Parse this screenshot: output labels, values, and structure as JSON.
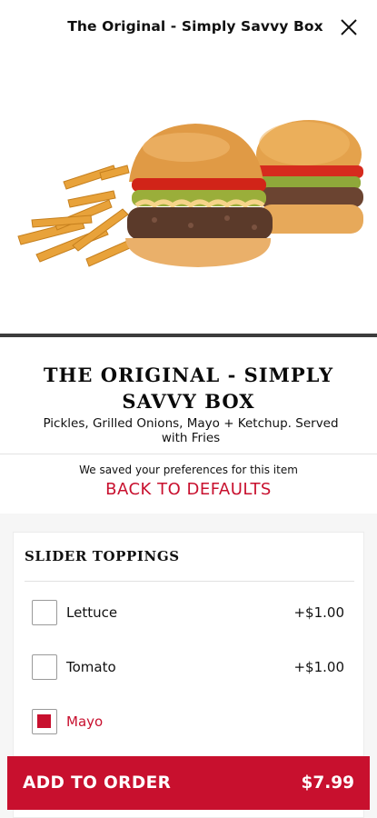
{
  "header": {
    "title": "The Original - Simply Savvy Box"
  },
  "product": {
    "name_line1": "THE ORIGINAL - SIMPLY",
    "name_line2": "SAVVY BOX",
    "desc_line1": "Pickles, Grilled Onions, Mayo + Ketchup. Served",
    "desc_line2": "with Fries"
  },
  "preferences": {
    "note": "We saved your preferences for this item",
    "reset_label": "BACK TO DEFAULTS"
  },
  "toppings": {
    "title": "SLIDER TOPPINGS",
    "options": [
      {
        "label": "Lettuce",
        "price": "+$1.00",
        "checked": false
      },
      {
        "label": "Tomato",
        "price": "+$1.00",
        "checked": false
      },
      {
        "label": "Mayo",
        "price": "",
        "checked": true
      }
    ]
  },
  "order_button": {
    "label": "ADD TO ORDER",
    "price": "$7.99"
  },
  "colors": {
    "brand_red": "#c8102e",
    "divider": "#3d3d3d"
  },
  "icons": {
    "close": "close-icon"
  }
}
